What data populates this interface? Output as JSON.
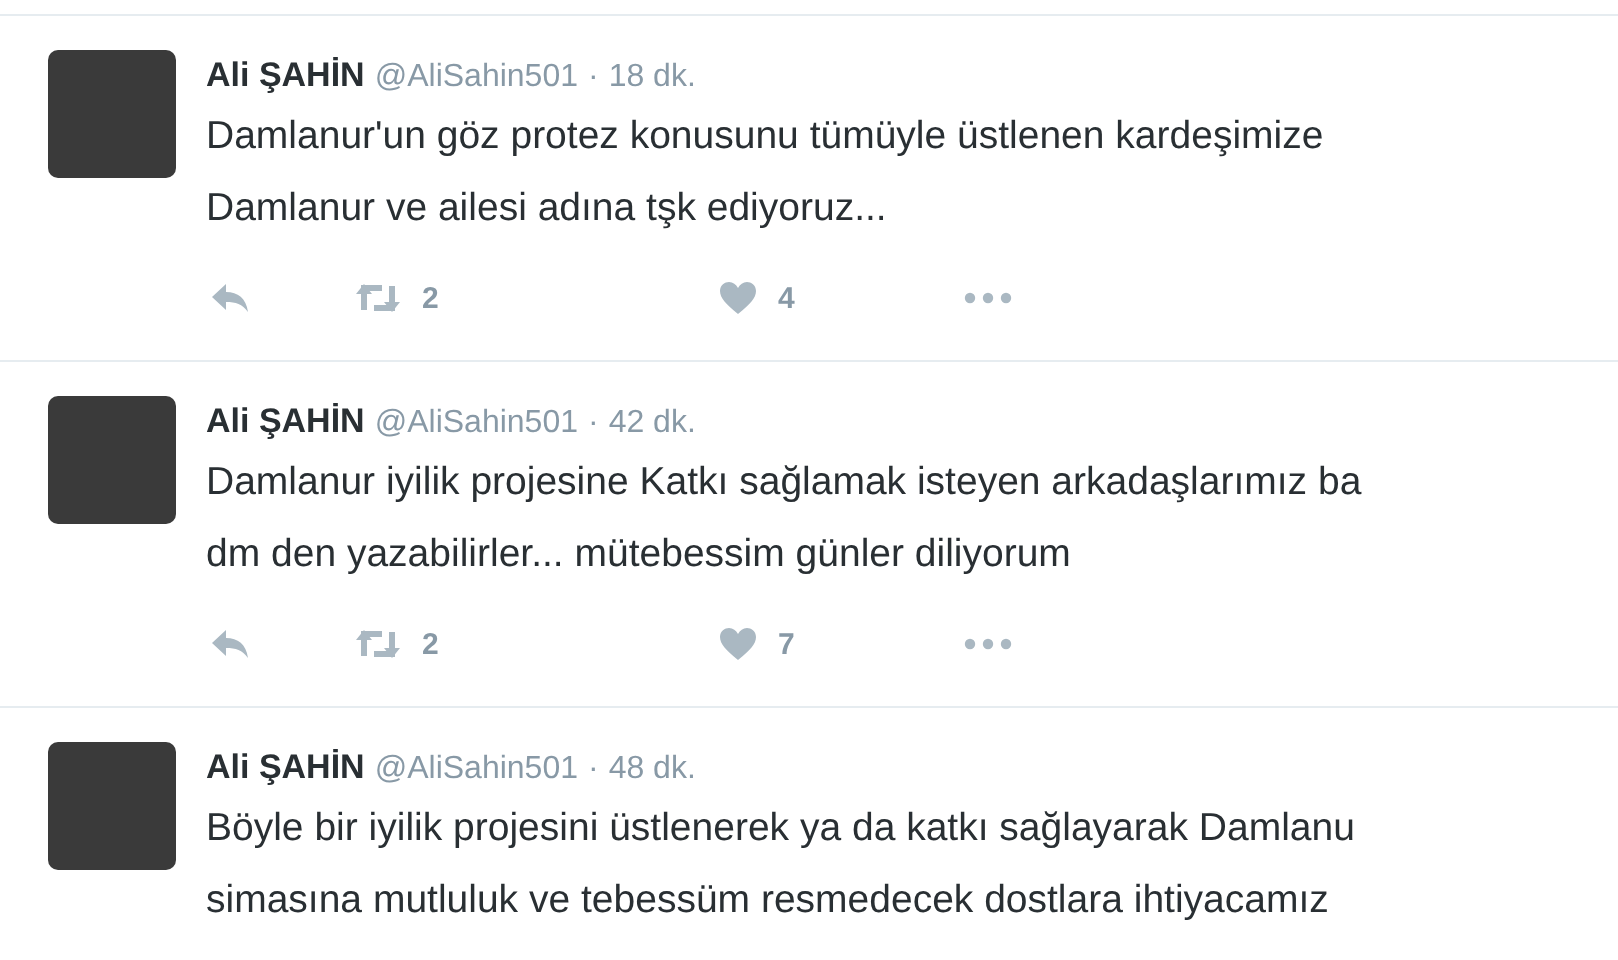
{
  "tweets": [
    {
      "name": "Ali ŞAHİN",
      "handle": "@AliSahin501",
      "separator": "·",
      "time": "18 dk.",
      "lines": [
        "Damlanur'un göz protez konusunu tümüyle üstlenen kardeşimize",
        "Damlanur ve ailesi adına tşk ediyoruz..."
      ],
      "retweets": "2",
      "likes": "4"
    },
    {
      "name": "Ali ŞAHİN",
      "handle": "@AliSahin501",
      "separator": "·",
      "time": "42 dk.",
      "lines": [
        "Damlanur iyilik projesine Katkı sağlamak isteyen arkadaşlarımız ba",
        "dm den yazabilirler... mütebessim günler diliyorum"
      ],
      "retweets": "2",
      "likes": "7"
    },
    {
      "name": "Ali ŞAHİN",
      "handle": "@AliSahin501",
      "separator": "·",
      "time": "48 dk.",
      "lines": [
        "Böyle bir iyilik projesini üstlenerek ya da katkı sağlayarak Damlanu",
        "simasına mutluluk ve tebessüm resmedecek dostlara ihtiyacamız"
      ]
    }
  ]
}
